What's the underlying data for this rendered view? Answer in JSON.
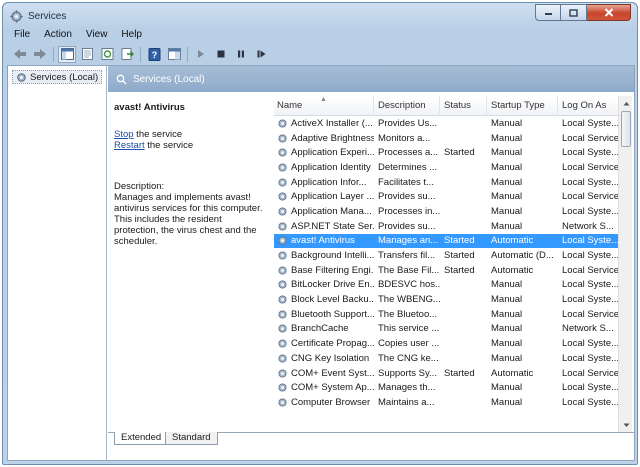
{
  "window": {
    "title": "Services"
  },
  "menu": [
    "File",
    "Action",
    "View",
    "Help"
  ],
  "toolbar": {
    "icons": [
      "back-arrow-icon",
      "forward-arrow-icon",
      "console-tree-icon",
      "properties-icon",
      "refresh-icon",
      "export-list-icon",
      "help-icon",
      "show-hide-icon",
      "play-icon",
      "stop-icon",
      "pause-icon",
      "restart-icon"
    ]
  },
  "tree": {
    "root_label": "Services (Local)"
  },
  "pane": {
    "header": "Services (Local)",
    "selected_service": "avast! Antivirus",
    "stop_link": "Stop",
    "stop_suffix": " the service",
    "restart_link": "Restart",
    "restart_suffix": " the service",
    "description_label": "Description:",
    "description_text": "Manages and implements avast! antivirus services for this computer. This includes the resident protection, the virus chest and the scheduler."
  },
  "columns": {
    "name": "Name",
    "description": "Description",
    "status": "Status",
    "startup": "Startup Type",
    "logon": "Log On As"
  },
  "services": [
    {
      "name": "ActiveX Installer (...",
      "description": "Provides Us...",
      "status": "",
      "startup": "Manual",
      "logon": "Local Syste..."
    },
    {
      "name": "Adaptive Brightness",
      "description": "Monitors a...",
      "status": "",
      "startup": "Manual",
      "logon": "Local Service"
    },
    {
      "name": "Application Experi...",
      "description": "Processes a...",
      "status": "Started",
      "startup": "Manual",
      "logon": "Local Syste..."
    },
    {
      "name": "Application Identity",
      "description": "Determines ...",
      "status": "",
      "startup": "Manual",
      "logon": "Local Service"
    },
    {
      "name": "Application Infor...",
      "description": "Facilitates t...",
      "status": "",
      "startup": "Manual",
      "logon": "Local Syste..."
    },
    {
      "name": "Application Layer ...",
      "description": "Provides su...",
      "status": "",
      "startup": "Manual",
      "logon": "Local Service"
    },
    {
      "name": "Application Mana...",
      "description": "Processes in...",
      "status": "",
      "startup": "Manual",
      "logon": "Local Syste..."
    },
    {
      "name": "ASP.NET State Ser...",
      "description": "Provides su...",
      "status": "",
      "startup": "Manual",
      "logon": "Network S..."
    },
    {
      "name": "avast! Antivirus",
      "description": "Manages an...",
      "status": "Started",
      "startup": "Automatic",
      "logon": "Local Syste...",
      "selected": true
    },
    {
      "name": "Background Intelli...",
      "description": "Transfers fil...",
      "status": "Started",
      "startup": "Automatic (D...",
      "logon": "Local Syste..."
    },
    {
      "name": "Base Filtering Engi...",
      "description": "The Base Fil...",
      "status": "Started",
      "startup": "Automatic",
      "logon": "Local Service"
    },
    {
      "name": "BitLocker Drive En...",
      "description": "BDESVC hos...",
      "status": "",
      "startup": "Manual",
      "logon": "Local Syste..."
    },
    {
      "name": "Block Level Backu...",
      "description": "The WBENG...",
      "status": "",
      "startup": "Manual",
      "logon": "Local Syste..."
    },
    {
      "name": "Bluetooth Support...",
      "description": "The Bluetoo...",
      "status": "",
      "startup": "Manual",
      "logon": "Local Service"
    },
    {
      "name": "BranchCache",
      "description": "This service ...",
      "status": "",
      "startup": "Manual",
      "logon": "Network S..."
    },
    {
      "name": "Certificate Propag...",
      "description": "Copies user ...",
      "status": "",
      "startup": "Manual",
      "logon": "Local Syste..."
    },
    {
      "name": "CNG Key Isolation",
      "description": "The CNG ke...",
      "status": "",
      "startup": "Manual",
      "logon": "Local Syste..."
    },
    {
      "name": "COM+ Event Syst...",
      "description": "Supports Sy...",
      "status": "Started",
      "startup": "Automatic",
      "logon": "Local Service"
    },
    {
      "name": "COM+ System Ap...",
      "description": "Manages th...",
      "status": "",
      "startup": "Manual",
      "logon": "Local Syste..."
    },
    {
      "name": "Computer Browser",
      "description": "Maintains a...",
      "status": "",
      "startup": "Manual",
      "logon": "Local Syste..."
    }
  ],
  "tabs": {
    "extended": "Extended",
    "standard": "Standard"
  }
}
